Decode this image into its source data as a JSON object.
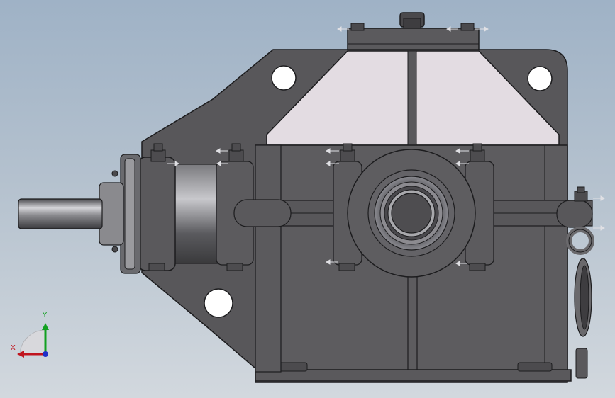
{
  "viewport": {
    "background_top": "#9fb2c6",
    "background_bottom": "#d2d8de",
    "model_body_color": "#555457",
    "model_edge_color": "#1c1c1e",
    "inspection_cover_color": "#e3dce2",
    "shaft_color": "#8c8c90"
  },
  "triad": {
    "x_label": "X",
    "y_label": "Y",
    "x_color": "#c0141e",
    "y_color": "#12a020",
    "z_color": "#2030c8"
  }
}
